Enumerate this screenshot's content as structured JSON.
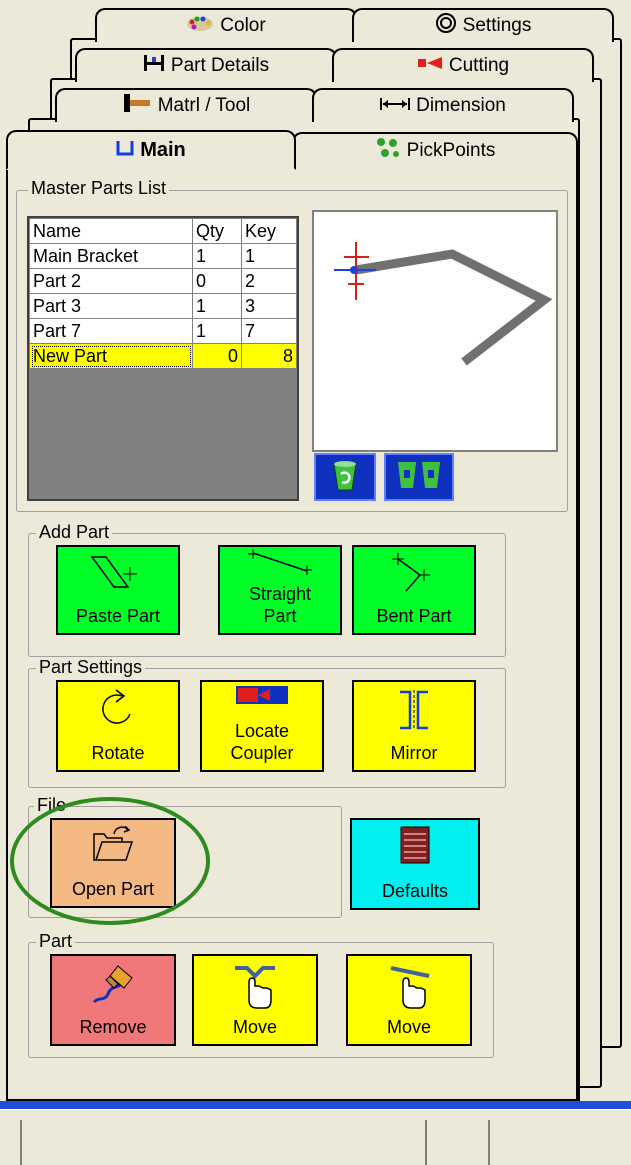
{
  "tabs": {
    "color": "Color",
    "settings": "Settings",
    "part_details": "Part Details",
    "cutting": "Cutting",
    "matrl_tool": "Matrl / Tool",
    "dimension": "Dimension",
    "main": "Main",
    "pickpoints": "PickPoints"
  },
  "master_parts_list": {
    "label": "Master Parts List",
    "columns": [
      "Name",
      "Qty",
      "Key"
    ],
    "rows": [
      {
        "name": "Main Bracket",
        "qty": "1",
        "key": "1"
      },
      {
        "name": "Part 2",
        "qty": "0",
        "key": "2"
      },
      {
        "name": "Part 3",
        "qty": "1",
        "key": "3"
      },
      {
        "name": "Part 7",
        "qty": "1",
        "key": "7"
      },
      {
        "name": "New Part",
        "qty": "0",
        "key": "8"
      }
    ]
  },
  "add_part": {
    "label": "Add Part",
    "paste": "Paste Part",
    "straight_line1": "Straight",
    "straight_line2": "Part",
    "bent": "Bent Part"
  },
  "part_settings": {
    "label": "Part Settings",
    "rotate": "Rotate",
    "locate_line1": "Locate",
    "locate_line2": "Coupler",
    "mirror": "Mirror"
  },
  "file": {
    "label": "File",
    "open": "Open Part",
    "defaults": "Defaults"
  },
  "part": {
    "label": "Part",
    "remove": "Remove",
    "move1": "Move",
    "move2": "Move"
  },
  "colors": {
    "green": "#00ff29",
    "yellow": "#ffff00",
    "cyan": "#00f0f0",
    "pink": "#f07878",
    "orange": "#f4b882",
    "highlight_ring": "#2e8b1e",
    "status_bar": "#1f4fd8"
  }
}
